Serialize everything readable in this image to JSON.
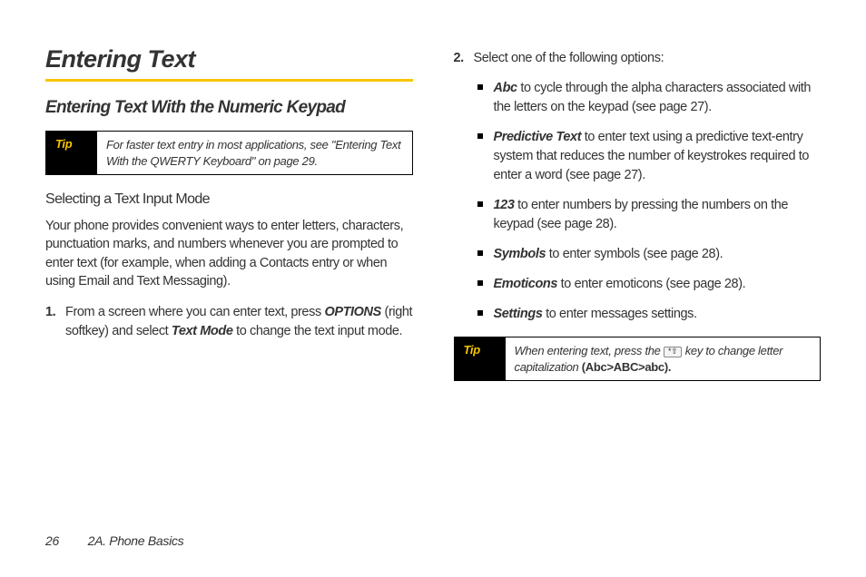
{
  "heading": "Entering Text",
  "subheading": "Entering Text With the Numeric Keypad",
  "tip1": {
    "label": "Tip",
    "text_pre": "For faster text entry in most applications, see ",
    "ref": "\"Entering Text With the QWERTY Keyboard\" on page 29.",
    "text_post": ""
  },
  "section3": "Selecting a Text Input Mode",
  "intro": "Your phone provides convenient ways to enter letters, characters, punctuation marks, and numbers whenever you are prompted to enter text (for example, when adding a Contacts entry or when using Email and Text Messaging).",
  "step1": {
    "pre": "From a screen where you can enter text, press ",
    "options": "OPTIONS",
    "mid": " (right softkey) and select ",
    "textmode": "Text Mode",
    "post": " to change the text input mode."
  },
  "step2_lead": "Select one of the following options:",
  "bullets": {
    "abc_label": "Abc",
    "abc_text": " to cycle through the alpha characters associated with the letters on the keypad (see page 27).",
    "pred_label": "Predictive Text",
    "pred_text": " to enter text using a predictive text-entry system that reduces the number of keystrokes required to enter a word (see page 27).",
    "num_label": "123",
    "num_text": " to enter numbers by pressing the numbers on the keypad (see page 28).",
    "sym_label": "Symbols",
    "sym_text": " to enter symbols (see page 28).",
    "emo_label": "Emoticons",
    "emo_text": " to enter emoticons (see page 28).",
    "set_label": "Settings",
    "set_text": " to enter messages settings."
  },
  "tip2": {
    "label": "Tip",
    "pre": "When entering text, press the ",
    "key": "*⇧",
    "mid": " key to change letter capitalization ",
    "example": "(Abc>ABC>abc)."
  },
  "footer": {
    "page": "26",
    "section": "2A. Phone Basics"
  }
}
